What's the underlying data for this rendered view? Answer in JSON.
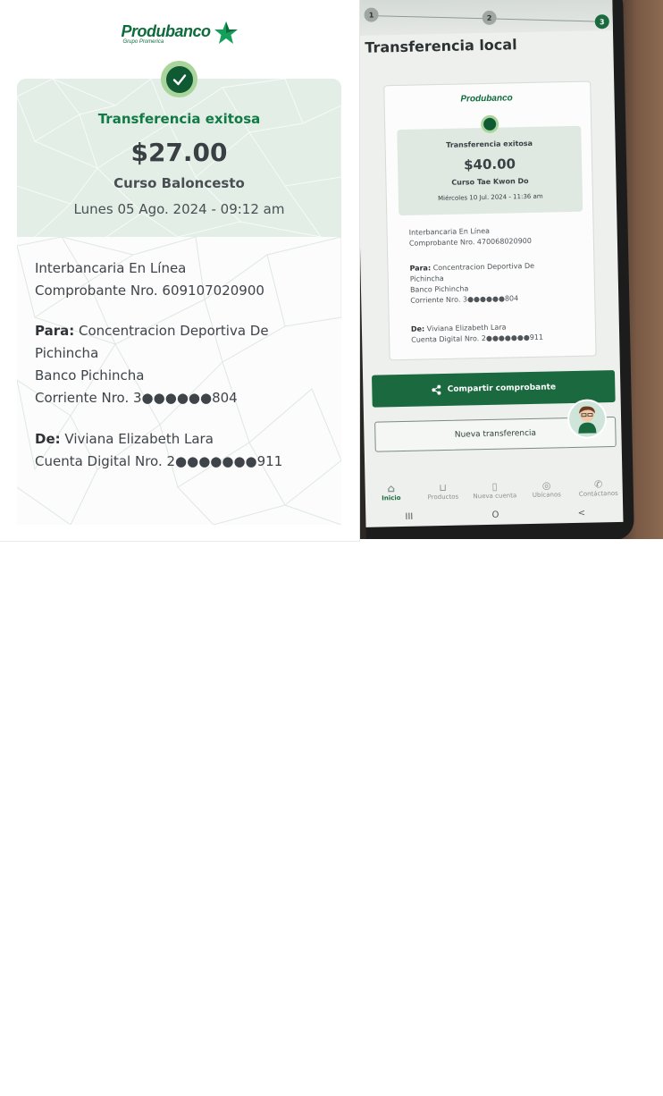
{
  "receipt": {
    "brand_name": "Produbanco",
    "brand_sub": "Grupo Promerica",
    "status": "Transferencia exitosa",
    "amount": "$27.00",
    "concept": "Curso Baloncesto",
    "date": "Lunes 05 Ago. 2024 - 09:12 am",
    "type": "Interbancaria En Línea",
    "voucher": "Comprobante Nro. 609107020900",
    "to_label": "Para:",
    "to_name_line1": "Concentracion Deportiva De",
    "to_name_line2": "Pichincha",
    "to_bank": "Banco Pichincha",
    "to_account": "Corriente Nro. 3●●●●●●804",
    "from_label": "De:",
    "from_name": "Viviana Elizabeth Lara",
    "from_account": "Cuenta Digital Nro. 2●●●●●●●911"
  },
  "photo": {
    "steps": [
      "1",
      "2",
      "3"
    ],
    "title": "Transferencia local",
    "brand": "Produbanco",
    "status": "Transferencia exitosa",
    "amount": "$40.00",
    "concept": "Curso Tae Kwon Do",
    "date": "Miércoles 10 Jul. 2024 - 11:36 am",
    "type": "Interbancaria En Línea",
    "voucher": "Comprobante Nro. 470068020900",
    "to_label": "Para:",
    "to_name_line1": "Concentracion Deportiva De",
    "to_name_line2": "Pichincha",
    "to_bank": "Banco Pichincha",
    "to_account": "Corriente Nro. 3●●●●●●804",
    "from_label": "De:",
    "from_name": "Viviana Elizabeth Lara",
    "from_account": "Cuenta Digital Nro. 2●●●●●●●911",
    "share_button": "Compartir comprobante",
    "new_button": "Nueva transferencia",
    "nav": [
      "Inicio",
      "Productos",
      "Nueva cuenta",
      "Ubícanos",
      "Contáctanos"
    ],
    "sys_buttons": [
      "III",
      "O",
      "<"
    ]
  },
  "colors": {
    "brand_green": "#0e6b3c",
    "status_green": "#127a45",
    "header_bg": "#e2eee6",
    "check_outer": "#a9d49b",
    "check_inner": "#0f5a33"
  }
}
